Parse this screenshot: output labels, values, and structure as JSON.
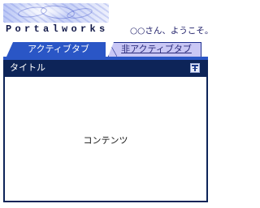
{
  "header": {
    "logo_text": "Portalworks",
    "welcome_message": "○○さん、ようこそ。"
  },
  "tabs": [
    {
      "label": "アクティブタブ",
      "active": true
    },
    {
      "label": "非アクティブタブ",
      "active": false
    }
  ],
  "portlet": {
    "title": "タイトル",
    "content": "コンテンツ",
    "titlebar_icon": "window-control-icon"
  },
  "colors": {
    "tab_active": "#2a56c6",
    "tab_inactive": "#c9c7f5",
    "portlet_frame": "#0d2458",
    "logo_text": "#131a4a"
  }
}
